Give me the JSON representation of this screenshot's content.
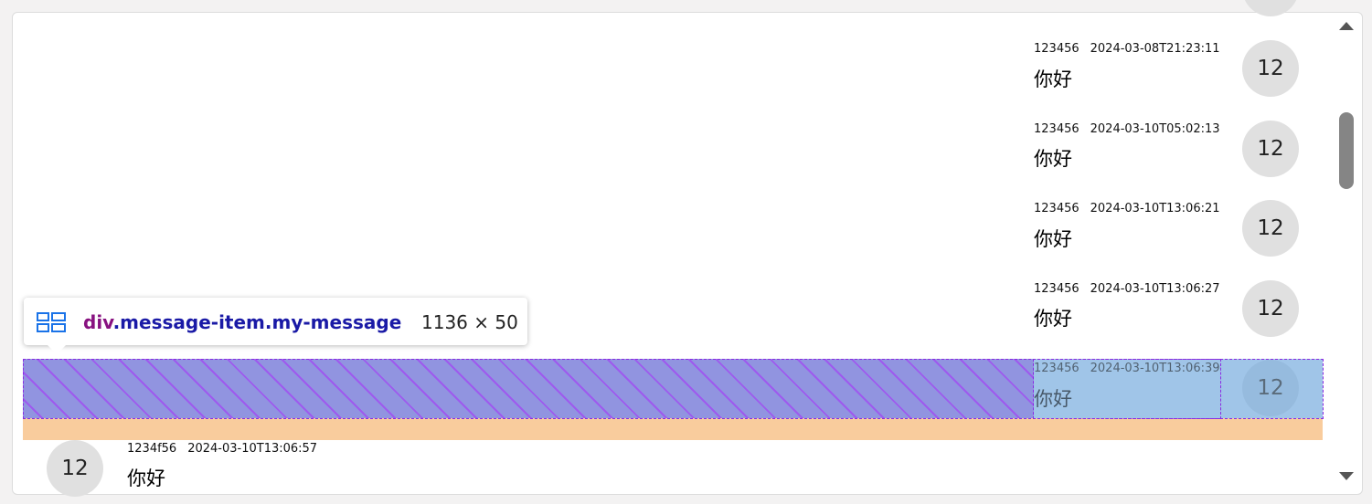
{
  "messages": [
    {
      "user": "123456",
      "time": "2024-03-08T21:23:11",
      "text": "你好",
      "avatar": "12"
    },
    {
      "user": "123456",
      "time": "2024-03-10T05:02:13",
      "text": "你好",
      "avatar": "12"
    },
    {
      "user": "123456",
      "time": "2024-03-10T13:06:21",
      "text": "你好",
      "avatar": "12"
    },
    {
      "user": "123456",
      "time": "2024-03-10T13:06:27",
      "text": "你好",
      "avatar": "12"
    },
    {
      "user": "123456",
      "time": "2024-03-10T13:06:39",
      "text": "你好",
      "avatar": "12"
    }
  ],
  "other_message": {
    "user": "1234f56",
    "time": "2024-03-10T13:06:57",
    "text": "你好",
    "avatar": "12"
  },
  "inspector": {
    "tag": "div",
    "classes": ".message-item.my-message",
    "size": "1136 × 50",
    "icon": "grid-layout-icon"
  },
  "colors": {
    "content_highlight": "#a0c5e8",
    "margin_highlight": "#f9cc9d",
    "gap_highlight": "#9194e0",
    "avatar_bg": "#e0e0e0"
  }
}
